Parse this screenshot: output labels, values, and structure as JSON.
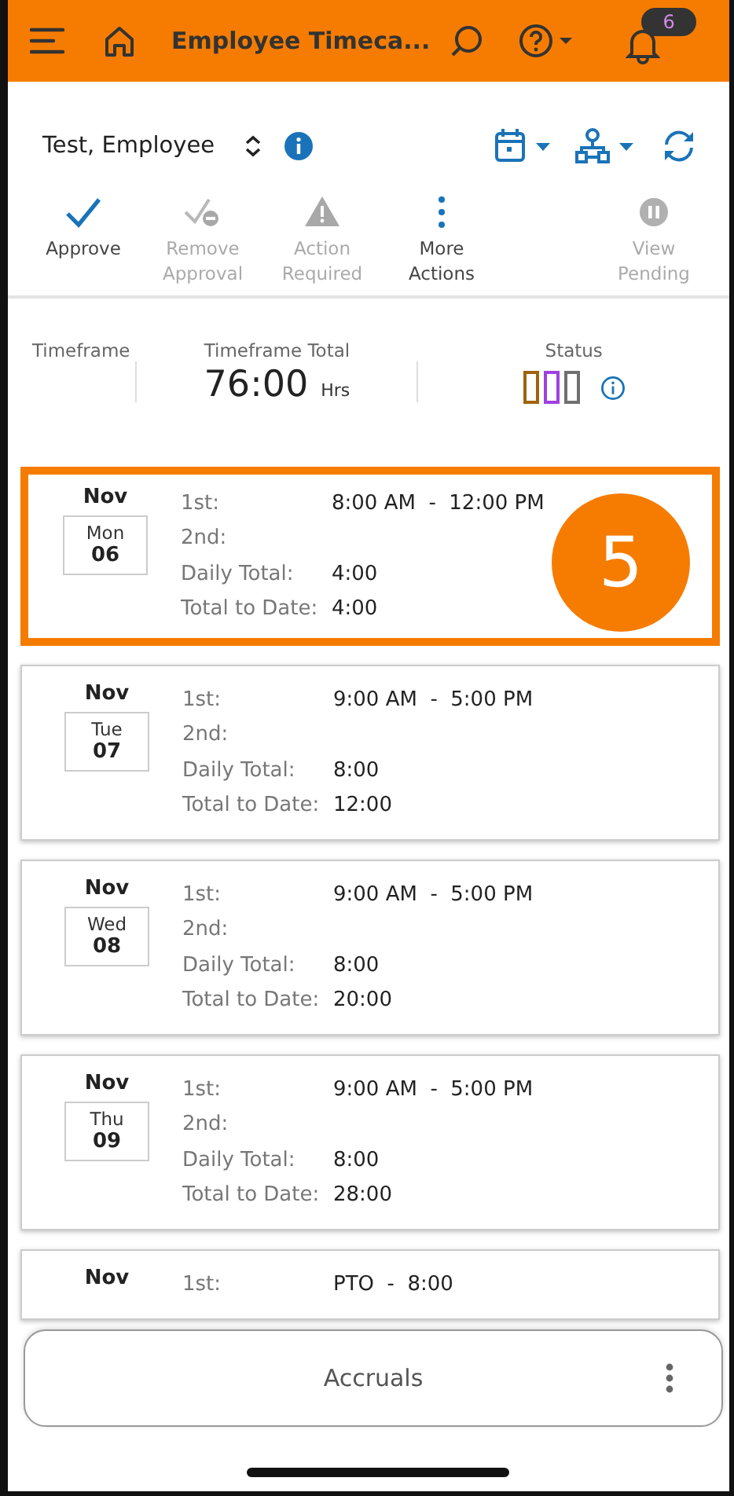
{
  "header": {
    "title": "Employee Timeca...",
    "notification_count": "6"
  },
  "employee": {
    "name": "Test, Employee"
  },
  "actions": [
    {
      "kind": "check",
      "label": "Approve",
      "disabled": false
    },
    {
      "kind": "remove",
      "label": "Remove Approval",
      "disabled": true
    },
    {
      "kind": "warning",
      "label": "Action Required",
      "disabled": true
    },
    {
      "kind": "more",
      "label": "More Actions",
      "disabled": false
    },
    {
      "kind": "pause",
      "label": "View Pending",
      "disabled": true
    }
  ],
  "summary": {
    "timeframe_label": "Timeframe",
    "total_label": "Timeframe Total",
    "total": "76:00",
    "unit": "Hrs",
    "status_label": "Status",
    "status_marks": [
      {
        "color": "#a0620a"
      },
      {
        "color": "#a040e0"
      },
      {
        "color": "#707070"
      }
    ]
  },
  "days": [
    {
      "month": "Nov",
      "weekday": "Mon",
      "date": "06",
      "highlighted": true,
      "badge": "5",
      "rows": [
        {
          "label": "1st:",
          "value": "8:00 AM  -  12:00 PM"
        },
        {
          "label": "2nd:",
          "value": ""
        },
        {
          "label": "Daily Total:",
          "value": "4:00"
        },
        {
          "label": "Total to Date:",
          "value": "4:00"
        }
      ]
    },
    {
      "month": "Nov",
      "weekday": "Tue",
      "date": "07",
      "highlighted": false,
      "rows": [
        {
          "label": "1st:",
          "value": "9:00 AM  -  5:00 PM"
        },
        {
          "label": "2nd:",
          "value": ""
        },
        {
          "label": "Daily Total:",
          "value": "8:00"
        },
        {
          "label": "Total to Date:",
          "value": "12:00"
        }
      ]
    },
    {
      "month": "Nov",
      "weekday": "Wed",
      "date": "08",
      "highlighted": false,
      "rows": [
        {
          "label": "1st:",
          "value": "9:00 AM  -  5:00 PM"
        },
        {
          "label": "2nd:",
          "value": ""
        },
        {
          "label": "Daily Total:",
          "value": "8:00"
        },
        {
          "label": "Total to Date:",
          "value": "20:00"
        }
      ]
    },
    {
      "month": "Nov",
      "weekday": "Thu",
      "date": "09",
      "highlighted": false,
      "rows": [
        {
          "label": "1st:",
          "value": "9:00 AM  -  5:00 PM"
        },
        {
          "label": "2nd:",
          "value": ""
        },
        {
          "label": "Daily Total:",
          "value": "8:00"
        },
        {
          "label": "Total to Date:",
          "value": "28:00"
        }
      ]
    },
    {
      "month": "Nov",
      "highlighted": false,
      "rows": [
        {
          "label": "1st:",
          "value": "PTO  -  8:00"
        }
      ]
    }
  ],
  "bottom_sheet": {
    "title": "Accruals"
  }
}
